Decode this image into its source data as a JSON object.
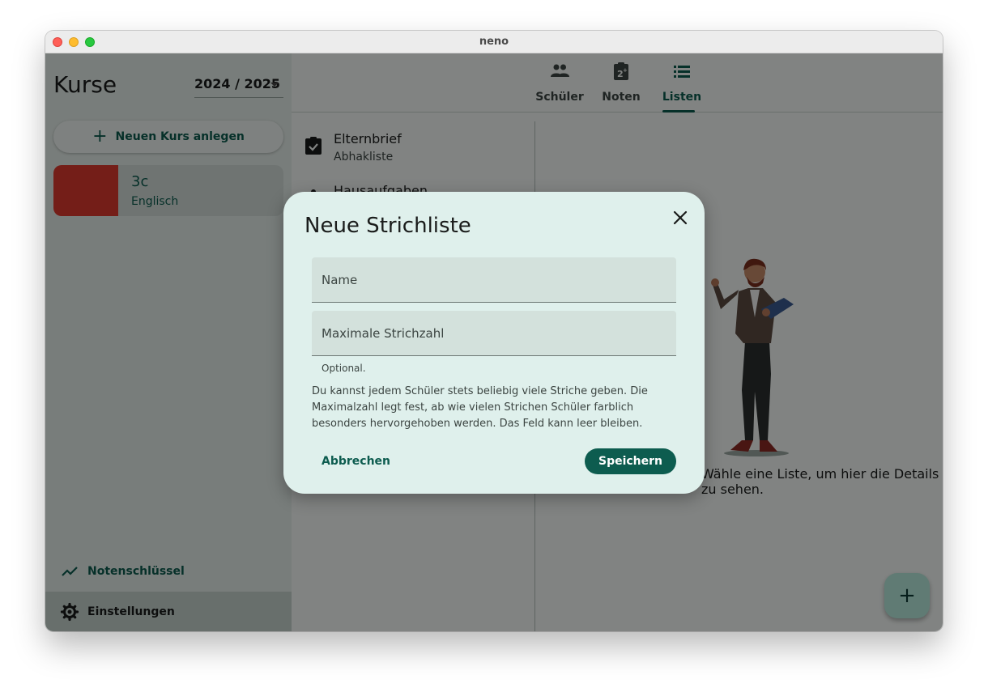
{
  "window": {
    "title": "neno"
  },
  "sidebar": {
    "title": "Kurse",
    "year_selector": "2024 / 2025",
    "new_course_label": "Neuen Kurs anlegen",
    "courses": [
      {
        "name": "3c",
        "subject": "Englisch",
        "color": "#dc3a2e"
      }
    ],
    "grading_key_label": "Notenschlüssel",
    "settings_label": "Einstellungen"
  },
  "tabs": [
    {
      "label": "Schüler",
      "icon": "people-icon"
    },
    {
      "label": "Noten",
      "icon": "grade-clipboard-icon"
    },
    {
      "label": "Listen",
      "icon": "list-icon",
      "active": true
    }
  ],
  "lists": [
    {
      "title": "Elternbrief",
      "subtitle": "Abhakliste",
      "icon": "clipboard-check-icon"
    },
    {
      "title": "Hausaufgaben",
      "subtitle": "",
      "icon": "dot-icon"
    }
  ],
  "detail": {
    "hint": "Wähle eine Liste, um hier die Details zu sehen."
  },
  "dialog": {
    "title": "Neue Strichliste",
    "name_placeholder": "Name",
    "max_placeholder": "Maximale Strichzahl",
    "helper": "Optional.",
    "description": "Du kannst jedem Schüler stets beliebig viele Striche geben. Die Maximalzahl legt fest, ab wie vielen Strichen Schüler farblich besonders hervorgehoben werden. Das Feld kann leer bleiben.",
    "cancel_label": "Abbrechen",
    "save_label": "Speichern"
  },
  "colors": {
    "primary": "#0d5c4f",
    "dialog_bg": "#dff0ec",
    "course_color": "#dc3a2e"
  }
}
